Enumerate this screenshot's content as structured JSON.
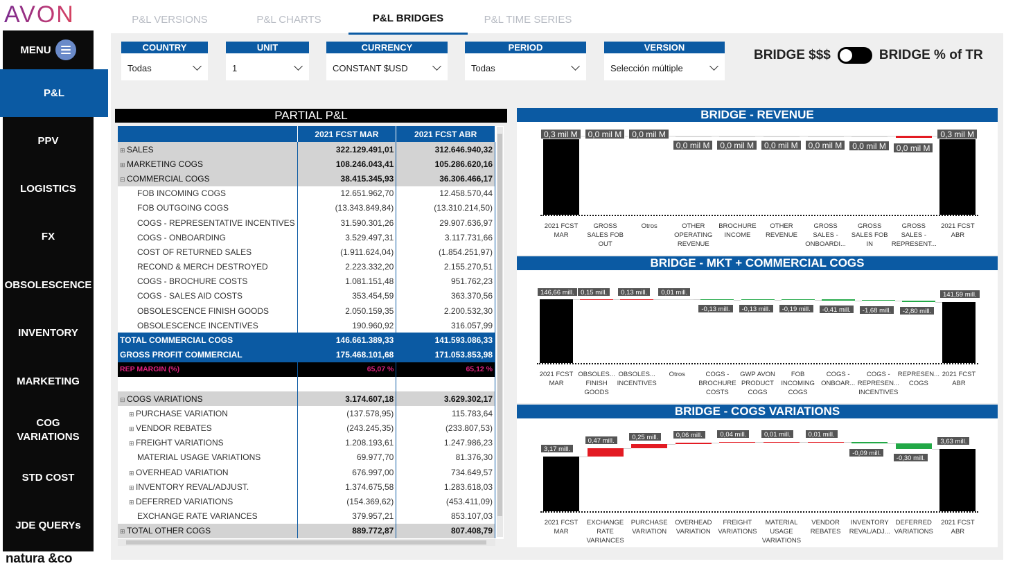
{
  "brand": {
    "logo": "AVON",
    "footer_logo": "natura &co"
  },
  "sidebar": {
    "menu_label": "MENU",
    "items": [
      {
        "label": "P&L"
      },
      {
        "label": "PPV"
      },
      {
        "label": "LOGISTICS"
      },
      {
        "label": "FX"
      },
      {
        "label": "OBSOLESCENCE"
      },
      {
        "label": "INVENTORY"
      },
      {
        "label": "MARKETING"
      },
      {
        "label": "COG VARIATIONS"
      },
      {
        "label": "STD COST"
      },
      {
        "label": "JDE QUERYs"
      }
    ]
  },
  "tabs": [
    {
      "label": "P&L VERSIONS"
    },
    {
      "label": "P&L CHARTS"
    },
    {
      "label": "P&L BRIDGES"
    },
    {
      "label": "P&L TIME SERIES"
    }
  ],
  "filters": [
    {
      "label": "COUNTRY",
      "value": "Todas"
    },
    {
      "label": "UNIT",
      "value": "1"
    },
    {
      "label": "CURRENCY",
      "value": "CONSTANT $USD"
    },
    {
      "label": "PERIOD",
      "value": "Todas"
    },
    {
      "label": "VERSION",
      "value": "Selección múltiple"
    }
  ],
  "toggle": {
    "left_label": "BRIDGE $$$",
    "right_label": "BRIDGE % of TR"
  },
  "pl": {
    "title": "PARTIAL P&L",
    "columns": [
      "2021 FCST MAR",
      "2021 FCST ABR"
    ],
    "rows": [
      {
        "type": "grp",
        "pm": "⊞",
        "label": "SALES",
        "v1": "322.129.491,01",
        "v2": "312.646.940,32"
      },
      {
        "type": "grp",
        "pm": "⊞",
        "label": "MARKETING COGS",
        "v1": "108.246.043,41",
        "v2": "105.286.620,16"
      },
      {
        "type": "grp",
        "pm": "⊟",
        "label": "COMMERCIAL COGS",
        "v1": "38.415.345,93",
        "v2": "36.306.466,17"
      },
      {
        "type": "sub",
        "label": "FOB INCOMING COGS",
        "v1": "12.651.962,70",
        "v2": "12.458.570,44"
      },
      {
        "type": "sub",
        "label": "FOB OUTGOING COGS",
        "v1": "(13.343.849,84)",
        "v2": "(13.310.214,50)"
      },
      {
        "type": "sub",
        "label": "COGS - REPRESENTATIVE INCENTIVES",
        "v1": "31.590.301,26",
        "v2": "29.907.636,97"
      },
      {
        "type": "sub",
        "label": "COGS - ONBOARDING",
        "v1": "3.529.497,31",
        "v2": "3.117.731,66"
      },
      {
        "type": "sub",
        "label": "COST OF RETURNED SALES",
        "v1": "(1.911.624,04)",
        "v2": "(1.854.251,97)"
      },
      {
        "type": "sub",
        "label": "RECOND & MERCH DESTROYED",
        "v1": "2.223.332,20",
        "v2": "2.155.270,51"
      },
      {
        "type": "sub",
        "label": "COGS - BROCHURE COSTS",
        "v1": "1.081.151,48",
        "v2": "951.762,23"
      },
      {
        "type": "sub",
        "label": "COGS - SALES AID COSTS",
        "v1": "353.454,59",
        "v2": "363.370,56"
      },
      {
        "type": "sub",
        "label": "OBSOLESCENCE FINISH GOODS",
        "v1": "2.050.159,35",
        "v2": "2.200.532,30"
      },
      {
        "type": "sub",
        "label": "OBSOLESCENCE INCENTIVES",
        "v1": "190.960,92",
        "v2": "316.057,99"
      },
      {
        "type": "tot",
        "label": "TOTAL COMMERCIAL COGS",
        "v1": "146.661.389,33",
        "v2": "141.593.086,33"
      },
      {
        "type": "tot",
        "label": "GROSS PROFIT COMMERCIAL",
        "v1": "175.468.101,68",
        "v2": "171.053.853,98"
      },
      {
        "type": "rep",
        "label": "REP MARGIN (%)",
        "v1": "65,07 %",
        "v2": "65,12 %"
      },
      {
        "type": "blank",
        "label": "",
        "v1": "",
        "v2": ""
      },
      {
        "type": "grp",
        "pm": "⊟",
        "label": "COGS VARIATIONS",
        "v1": "3.174.607,18",
        "v2": "3.629.302,17"
      },
      {
        "type": "sub2",
        "pm": "⊞",
        "label": "PURCHASE VARIATION",
        "v1": "(137.578,95)",
        "v2": "115.783,64"
      },
      {
        "type": "sub2",
        "pm": "⊞",
        "label": "VENDOR REBATES",
        "v1": "(243.245,35)",
        "v2": "(233.807,53)"
      },
      {
        "type": "sub2",
        "pm": "⊞",
        "label": "FREIGHT VARIATIONS",
        "v1": "1.208.193,61",
        "v2": "1.247.986,23"
      },
      {
        "type": "sub",
        "label": "MATERIAL USAGE VARIATIONS",
        "v1": "69.977,70",
        "v2": "81.376,30"
      },
      {
        "type": "sub2",
        "pm": "⊞",
        "label": "OVERHEAD VARIATION",
        "v1": "676.997,00",
        "v2": "734.649,57"
      },
      {
        "type": "sub2",
        "pm": "⊞",
        "label": "INVENTORY REVAL/ADJUST.",
        "v1": "1.374.675,58",
        "v2": "1.283.618,03"
      },
      {
        "type": "sub2",
        "pm": "⊞",
        "label": "DEFERRED VARIATIONS",
        "v1": "(154.369,62)",
        "v2": "(453.411,09)"
      },
      {
        "type": "sub",
        "label": "EXCHANGE RATE VARIANCES",
        "v1": "379.957,21",
        "v2": "853.107,03"
      },
      {
        "type": "grp",
        "pm": "⊞",
        "label": "TOTAL OTHER COGS",
        "v1": "889.772,87",
        "v2": "807.408,79"
      }
    ]
  },
  "bridges": [
    {
      "title": "BRIDGE - REVENUE",
      "labels": [
        "0,3 mil M",
        "0,0 mil M",
        "0,0 mil M",
        "0,0 mil M",
        "0,0 mil M",
        "0,0 mil M",
        "0,0 mil M",
        "0,0 mil M",
        "0,0 mil M",
        "0,3 mil M"
      ],
      "categories": [
        "2021 FCST MAR",
        "GROSS SALES FOB OUT",
        "Otros",
        "OTHER OPERATING REVENUE",
        "BROCHURE INCOME",
        "OTHER REVENUE",
        "GROSS SALES - ONBOARDI...",
        "GROSS SALES FOB IN",
        "GROSS SALES - REPRESENT...",
        "2021 FCST ABR"
      ]
    },
    {
      "title": "BRIDGE - MKT + COMMERCIAL COGS",
      "labels": [
        "146,66 mill.",
        "0,15 mill.",
        "0,13 mill.",
        "0,01 mill.",
        "-0,13 mill.",
        "-0,13 mill.",
        "-0,19 mill.",
        "-0,41 mill.",
        "-1,68 mill.",
        "-2,80 mill.",
        "141,59 mill."
      ],
      "categories": [
        "2021 FCST MAR",
        "OBSOLES... FINISH GOODS",
        "OBSOLES... INCENTIVES",
        "Otros",
        "COGS - BROCHURE COSTS",
        "GWP AVON PRODUCT COGS",
        "FOB INCOMING COGS",
        "COGS - ONBOAR...",
        "COGS - REPRESEN... INCENTIVES",
        "REPRESEN... COGS",
        "2021 FCST ABR"
      ]
    },
    {
      "title": "BRIDGE - COGS VARIATIONS",
      "labels": [
        "3,17 mill.",
        "0,47 mill.",
        "0,25 mill.",
        "0,06 mill.",
        "0,04 mill.",
        "0,01 mill.",
        "0,01 mill.",
        "-0,09 mill.",
        "-0,30 mill.",
        "3,63 mill."
      ],
      "categories": [
        "2021 FCST MAR",
        "EXCHANGE RATE VARIANCES",
        "PURCHASE VARIATION",
        "OVERHEAD VARIATION",
        "FREIGHT VARIATIONS",
        "MATERIAL USAGE VARIATIONS",
        "VENDOR REBATES",
        "INVENTORY REVAL/ADJ...",
        "DEFERRED VARIATIONS",
        "2021 FCST ABR"
      ]
    }
  ],
  "colors": {
    "brand_blue": "#0b5aa3",
    "increase_red": "#e31b23",
    "decrease_green": "#22a846",
    "rep_margin_pink": "#e0217f"
  }
}
